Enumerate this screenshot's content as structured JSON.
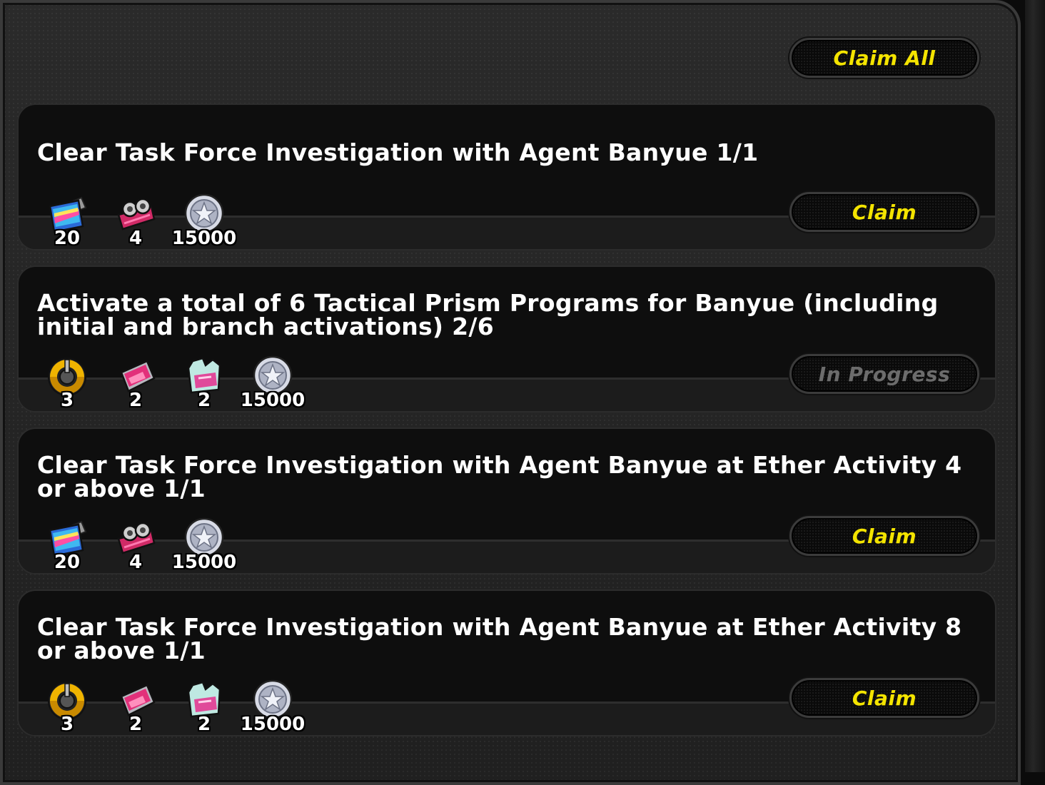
{
  "header": {
    "claim_all_label": "Claim All"
  },
  "tasks": [
    {
      "title": "Clear Task Force Investigation with Agent Banyue 1/1",
      "button": "Claim",
      "rewards": [
        {
          "icon": "film-ticket-icon",
          "qty": "20"
        },
        {
          "icon": "pink-camera-icon",
          "qty": "4"
        },
        {
          "icon": "silver-coin-icon",
          "qty": "15000"
        }
      ]
    },
    {
      "title": "Activate a total of 6 Tactical Prism Programs for Banyue (including initial and branch activations) 2/6",
      "button": "In Progress",
      "rewards": [
        {
          "icon": "gold-medal-icon",
          "qty": "3"
        },
        {
          "icon": "pink-disk-icon",
          "qty": "2"
        },
        {
          "icon": "pink-vest-icon",
          "qty": "2"
        },
        {
          "icon": "silver-coin-icon",
          "qty": "15000"
        }
      ]
    },
    {
      "title": "Clear Task Force Investigation with Agent Banyue at Ether Activity 4 or above 1/1",
      "button": "Claim",
      "rewards": [
        {
          "icon": "film-ticket-icon",
          "qty": "20"
        },
        {
          "icon": "pink-camera-icon",
          "qty": "4"
        },
        {
          "icon": "silver-coin-icon",
          "qty": "15000"
        }
      ]
    },
    {
      "title": "Clear Task Force Investigation with Agent Banyue at Ether Activity 8 or above 1/1",
      "button": "Claim",
      "rewards": [
        {
          "icon": "gold-medal-icon",
          "qty": "3"
        },
        {
          "icon": "pink-disk-icon",
          "qty": "2"
        },
        {
          "icon": "pink-vest-icon",
          "qty": "2"
        },
        {
          "icon": "silver-coin-icon",
          "qty": "15000"
        }
      ]
    }
  ],
  "colors": {
    "claim_text": "#f4e400",
    "in_progress_text": "#6c6c6c",
    "card_bg": "#0e0e0e",
    "panel_bg": "#262626"
  }
}
